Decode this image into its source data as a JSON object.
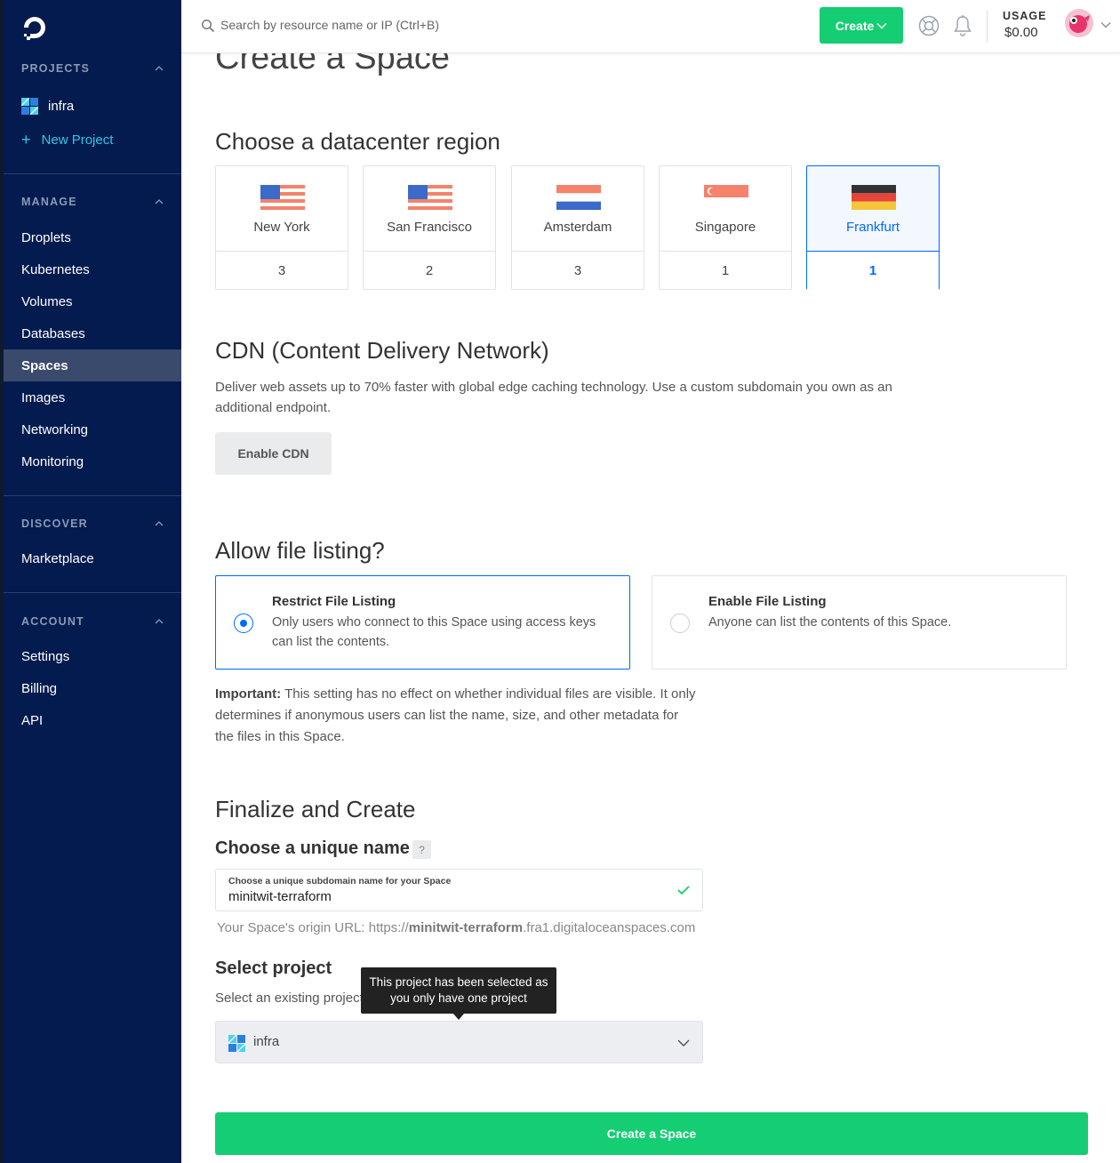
{
  "sidebar": {
    "sections": {
      "projects": "PROJECTS",
      "manage": "MANAGE",
      "discover": "DISCOVER",
      "account": "ACCOUNT"
    },
    "projects": [
      {
        "label": "infra"
      }
    ],
    "new_project": "New Project",
    "manage_items": [
      {
        "label": "Droplets"
      },
      {
        "label": "Kubernetes"
      },
      {
        "label": "Volumes"
      },
      {
        "label": "Databases"
      },
      {
        "label": "Spaces",
        "active": true
      },
      {
        "label": "Images"
      },
      {
        "label": "Networking"
      },
      {
        "label": "Monitoring"
      }
    ],
    "discover_items": [
      {
        "label": "Marketplace"
      }
    ],
    "account_items": [
      {
        "label": "Settings"
      },
      {
        "label": "Billing"
      },
      {
        "label": "API"
      }
    ]
  },
  "topbar": {
    "search_placeholder": "Search by resource name or IP (Ctrl+B)",
    "create_label": "Create",
    "usage_label": "USAGE",
    "usage_value": "$0.00"
  },
  "page": {
    "title": "Create a Space"
  },
  "region_section": {
    "heading": "Choose a datacenter region",
    "regions": [
      {
        "name": "New York",
        "count": "3",
        "flag": "us-flag-icon"
      },
      {
        "name": "San Francisco",
        "count": "2",
        "flag": "us-flag-icon"
      },
      {
        "name": "Amsterdam",
        "count": "3",
        "flag": "nl-flag-icon"
      },
      {
        "name": "Singapore",
        "count": "1",
        "flag": "sg-flag-icon"
      },
      {
        "name": "Frankfurt",
        "count": "1",
        "flag": "de-flag-icon",
        "selected": true
      }
    ]
  },
  "cdn": {
    "heading": "CDN (Content Delivery Network)",
    "description": "Deliver web assets up to 70% faster with global edge caching technology. Use a custom subdomain you own as an additional endpoint.",
    "button": "Enable CDN"
  },
  "listing": {
    "heading": "Allow file listing?",
    "options": [
      {
        "title": "Restrict File Listing",
        "description": "Only users who connect to this Space using access keys can list the contents.",
        "selected": true
      },
      {
        "title": "Enable File Listing",
        "description": "Anyone can list the contents of this Space.",
        "selected": false
      }
    ],
    "important_label": "Important:",
    "important_text": " This setting has no effect on whether individual files are visible. It only determines if anonymous users can list the name, size, and other metadata for the files in this Space."
  },
  "finalize": {
    "heading": "Finalize and Create",
    "name_heading": "Choose a unique name",
    "help_badge": "?",
    "field_label": "Choose a unique subdomain name for your Space",
    "field_value": "minitwit-terraform",
    "origin_prefix": "Your Space's origin URL: https://",
    "origin_name": "minitwit-terraform",
    "origin_suffix": ".fra1.digitaloceanspaces.com",
    "project_heading": "Select project",
    "project_desc": "Select an existing project",
    "tooltip": "This project has been selected as you only have one project",
    "selected_project": "infra",
    "submit": "Create a Space"
  },
  "colors": {
    "sidebar_bg": "#031b4e",
    "accent_green": "#15cd72",
    "accent_blue": "#0069ff"
  }
}
